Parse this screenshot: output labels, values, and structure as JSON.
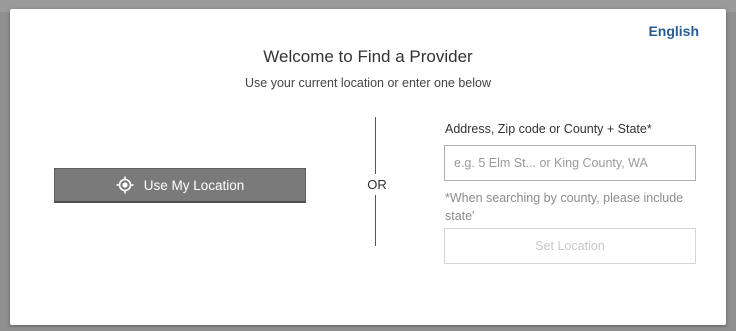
{
  "language_link": "English",
  "title": "Welcome to Find a Provider",
  "subtitle": "Use your current location or enter one below",
  "use_location": {
    "label": "Use My Location",
    "icon": "crosshair-location-icon"
  },
  "separator": "OR",
  "location_form": {
    "label": "Address, Zip code or County + State*",
    "placeholder": "e.g. 5 Elm St... or King County, WA",
    "value": "",
    "hint": "*When searching by county, please include state'",
    "submit_label": "Set Location"
  },
  "colors": {
    "link": "#2a5d8f",
    "primary_button": "#7a7a7a",
    "disabled_text": "#c8c8c8"
  }
}
